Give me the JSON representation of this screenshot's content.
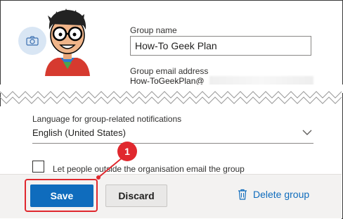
{
  "group_name": {
    "label": "Group name",
    "value": "How-To Geek Plan"
  },
  "group_email": {
    "label": "Group email address",
    "value_prefix": "How-ToGeekPlan@"
  },
  "language": {
    "label": "Language for group-related notifications",
    "selected": "English (United States)"
  },
  "external_access": {
    "label": "Let people outside the organisation email the group",
    "checked": false
  },
  "footer": {
    "save_label": "Save",
    "discard_label": "Discard",
    "delete_label": "Delete group"
  },
  "annotation": {
    "step_number": "1"
  },
  "colors": {
    "accent": "#0f6cbd",
    "callout": "#e0282e",
    "camera_circle": "#d9e6f4"
  },
  "icons": [
    "camera-icon",
    "chevron-down-icon",
    "trash-icon"
  ]
}
